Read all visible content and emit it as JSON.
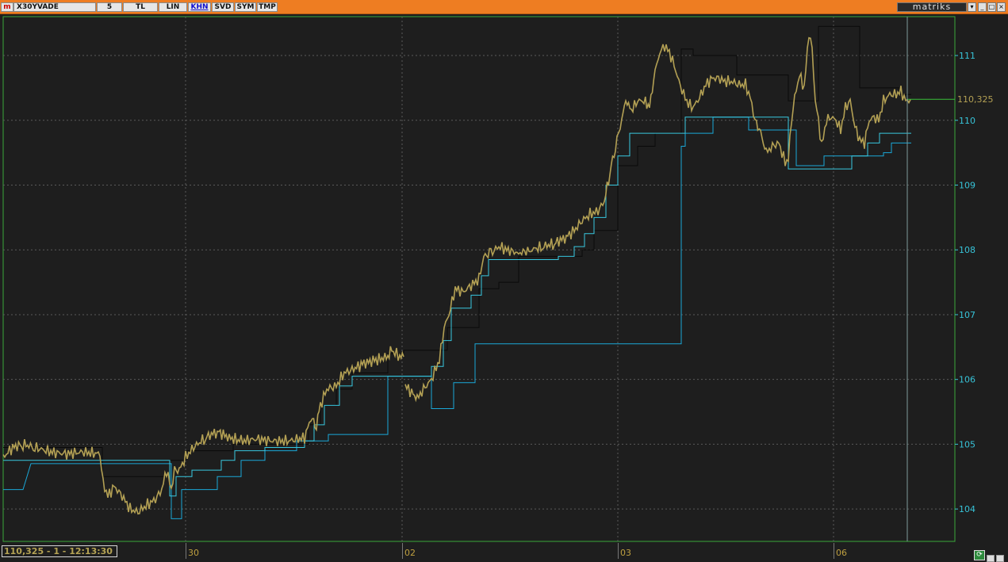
{
  "toolbar": {
    "logo": "m",
    "symbol": "X30YVADE",
    "buttons": [
      {
        "label": "5",
        "active": false
      },
      {
        "label": "TL",
        "active": false
      },
      {
        "label": "LIN",
        "active": false
      },
      {
        "label": "KHN",
        "active": true
      },
      {
        "label": "SVD",
        "active": false
      },
      {
        "label": "SYM",
        "active": false
      },
      {
        "label": "TMP",
        "active": false
      }
    ],
    "brand": "matriks",
    "window_controls": [
      "▾",
      "_",
      "□",
      "×"
    ]
  },
  "footer": {
    "readout": "110,325 - 1 - 12:13:30",
    "dates": [
      "30",
      "02",
      "03",
      "06"
    ]
  },
  "chart_data": {
    "type": "line",
    "price_label": "110,325",
    "y_ticks": [
      "104",
      "105",
      "106",
      "107",
      "108",
      "109",
      "110",
      "111"
    ],
    "ylim": [
      103.5,
      111.6
    ],
    "grid": true,
    "colors": {
      "price": "#b3a054",
      "upper_band": "#0a0a0a",
      "lower_band": "#38c8e0",
      "support": "#1aa8d8",
      "last_price_line": "#39c039",
      "axis_labels": "#37c3d8",
      "grid": "#5a5a5a"
    },
    "series": [
      {
        "key": "price",
        "values": [
          [
            0,
            104.8
          ],
          [
            12,
            104.95
          ],
          [
            25,
            105.0
          ],
          [
            40,
            104.95
          ],
          [
            60,
            104.88
          ],
          [
            80,
            104.85
          ],
          [
            100,
            104.88
          ],
          [
            122,
            104.85
          ],
          [
            126,
            104.4
          ],
          [
            132,
            104.2
          ],
          [
            140,
            104.35
          ],
          [
            150,
            104.2
          ],
          [
            160,
            104.0
          ],
          [
            170,
            103.95
          ],
          [
            180,
            104.05
          ],
          [
            192,
            104.15
          ],
          [
            200,
            104.3
          ],
          [
            206,
            104.6
          ],
          [
            212,
            104.3
          ],
          [
            216,
            104.6
          ],
          [
            222,
            104.6
          ],
          [
            230,
            104.8
          ],
          [
            240,
            104.95
          ],
          [
            255,
            105.1
          ],
          [
            270,
            105.2
          ],
          [
            285,
            105.1
          ],
          [
            300,
            105.05
          ],
          [
            320,
            105.08
          ],
          [
            340,
            105.05
          ],
          [
            360,
            105.05
          ],
          [
            380,
            105.1
          ],
          [
            388,
            105.4
          ],
          [
            395,
            105.3
          ],
          [
            400,
            105.6
          ],
          [
            408,
            105.85
          ],
          [
            420,
            105.9
          ],
          [
            430,
            106.1
          ],
          [
            440,
            106.15
          ],
          [
            455,
            106.25
          ],
          [
            470,
            106.3
          ],
          [
            485,
            106.35
          ],
          [
            490,
            106.45
          ],
          [
            500,
            106.35
          ],
          [
            505,
            106.35
          ]
        ]
      },
      {
        "key": "price2",
        "values": [
          [
            507,
            105.9
          ],
          [
            515,
            105.8
          ],
          [
            522,
            105.7
          ],
          [
            530,
            105.85
          ],
          [
            540,
            106.0
          ],
          [
            550,
            106.3
          ],
          [
            556,
            106.8
          ],
          [
            562,
            107.0
          ],
          [
            570,
            107.4
          ],
          [
            580,
            107.35
          ],
          [
            590,
            107.45
          ],
          [
            600,
            107.55
          ],
          [
            606,
            107.9
          ],
          [
            615,
            107.95
          ],
          [
            625,
            108.05
          ],
          [
            635,
            108.0
          ],
          [
            650,
            107.95
          ],
          [
            665,
            108.0
          ],
          [
            680,
            108.05
          ],
          [
            695,
            108.1
          ],
          [
            710,
            108.2
          ],
          [
            720,
            108.3
          ],
          [
            730,
            108.45
          ],
          [
            740,
            108.55
          ],
          [
            750,
            108.6
          ],
          [
            758,
            108.75
          ],
          [
            765,
            109.2
          ],
          [
            772,
            109.6
          ],
          [
            778,
            109.9
          ],
          [
            785,
            110.3
          ],
          [
            792,
            110.15
          ],
          [
            800,
            110.3
          ],
          [
            808,
            110.3
          ],
          [
            815,
            110.2
          ],
          [
            822,
            110.75
          ],
          [
            828,
            111.05
          ],
          [
            834,
            111.15
          ],
          [
            840,
            111.05
          ],
          [
            846,
            110.85
          ],
          [
            852,
            110.6
          ],
          [
            858,
            110.4
          ],
          [
            864,
            110.25
          ],
          [
            870,
            110.2
          ],
          [
            878,
            110.35
          ],
          [
            886,
            110.55
          ],
          [
            894,
            110.65
          ],
          [
            902,
            110.65
          ],
          [
            910,
            110.6
          ],
          [
            918,
            110.6
          ],
          [
            928,
            110.55
          ],
          [
            936,
            110.55
          ],
          [
            942,
            110.35
          ],
          [
            948,
            110.0
          ],
          [
            955,
            109.8
          ],
          [
            962,
            109.5
          ],
          [
            970,
            109.6
          ],
          [
            978,
            109.65
          ],
          [
            986,
            109.35
          ],
          [
            990,
            109.4
          ],
          [
            994,
            110.0
          ],
          [
            998,
            110.35
          ],
          [
            1004,
            110.7
          ],
          [
            1010,
            110.5
          ],
          [
            1016,
            111.35
          ],
          [
            1020,
            111.1
          ],
          [
            1024,
            110.3
          ],
          [
            1028,
            110.0
          ],
          [
            1032,
            109.6
          ],
          [
            1038,
            110.0
          ],
          [
            1044,
            110.05
          ],
          [
            1050,
            110.0
          ],
          [
            1056,
            109.85
          ],
          [
            1062,
            110.2
          ],
          [
            1068,
            110.3
          ],
          [
            1074,
            109.9
          ],
          [
            1080,
            109.7
          ],
          [
            1086,
            109.65
          ],
          [
            1092,
            110.0
          ],
          [
            1098,
            110.05
          ],
          [
            1104,
            110.0
          ],
          [
            1110,
            110.3
          ],
          [
            1118,
            110.4
          ],
          [
            1126,
            110.4
          ],
          [
            1132,
            110.45
          ],
          [
            1138,
            110.3
          ],
          [
            1144,
            110.32
          ]
        ]
      },
      {
        "key": "upper_band",
        "values": [
          [
            0,
            104.95
          ],
          [
            125,
            104.95
          ],
          [
            125,
            104.5
          ],
          [
            210,
            104.5
          ],
          [
            210,
            104.75
          ],
          [
            230,
            104.75
          ],
          [
            230,
            104.9
          ],
          [
            290,
            104.9
          ],
          [
            290,
            105.0
          ],
          [
            385,
            105.0
          ],
          [
            385,
            105.3
          ],
          [
            400,
            105.3
          ],
          [
            400,
            105.6
          ],
          [
            420,
            105.6
          ],
          [
            420,
            105.85
          ],
          [
            440,
            105.85
          ],
          [
            440,
            106.1
          ],
          [
            485,
            106.1
          ],
          [
            485,
            106.4
          ],
          [
            505,
            106.4
          ],
          [
            505,
            106.45
          ],
          [
            560,
            106.45
          ],
          [
            560,
            106.8
          ],
          [
            600,
            106.8
          ],
          [
            600,
            107.4
          ],
          [
            625,
            107.4
          ],
          [
            625,
            107.5
          ],
          [
            650,
            107.5
          ],
          [
            650,
            107.9
          ],
          [
            730,
            107.9
          ],
          [
            730,
            108.0
          ],
          [
            745,
            108.0
          ],
          [
            745,
            108.3
          ],
          [
            775,
            108.3
          ],
          [
            775,
            109.3
          ],
          [
            800,
            109.3
          ],
          [
            800,
            109.6
          ],
          [
            822,
            109.6
          ],
          [
            822,
            109.8
          ],
          [
            855,
            109.8
          ],
          [
            855,
            111.1
          ],
          [
            870,
            111.1
          ],
          [
            870,
            111.0
          ],
          [
            925,
            111.0
          ],
          [
            925,
            110.7
          ],
          [
            990,
            110.7
          ],
          [
            990,
            110.3
          ],
          [
            1028,
            110.3
          ],
          [
            1028,
            111.45
          ],
          [
            1080,
            111.45
          ],
          [
            1080,
            110.5
          ],
          [
            1130,
            110.5
          ],
          [
            1130,
            110.4
          ],
          [
            1145,
            110.4
          ]
        ]
      },
      {
        "key": "lower_band",
        "values": [
          [
            0,
            104.75
          ],
          [
            210,
            104.75
          ],
          [
            210,
            104.2
          ],
          [
            218,
            104.2
          ],
          [
            218,
            104.5
          ],
          [
            238,
            104.5
          ],
          [
            238,
            104.6
          ],
          [
            275,
            104.6
          ],
          [
            275,
            104.75
          ],
          [
            292,
            104.75
          ],
          [
            292,
            104.9
          ],
          [
            330,
            104.9
          ],
          [
            330,
            104.95
          ],
          [
            380,
            104.95
          ],
          [
            380,
            105.05
          ],
          [
            392,
            105.05
          ],
          [
            392,
            105.3
          ],
          [
            405,
            105.3
          ],
          [
            405,
            105.6
          ],
          [
            424,
            105.6
          ],
          [
            424,
            105.9
          ],
          [
            440,
            105.9
          ],
          [
            440,
            106.05
          ],
          [
            485,
            106.05
          ],
          [
            485,
            106.05
          ],
          [
            540,
            106.05
          ],
          [
            540,
            106.2
          ],
          [
            555,
            106.2
          ],
          [
            555,
            106.6
          ],
          [
            565,
            106.6
          ],
          [
            565,
            107.1
          ],
          [
            590,
            107.1
          ],
          [
            590,
            107.3
          ],
          [
            603,
            107.3
          ],
          [
            603,
            107.6
          ],
          [
            612,
            107.6
          ],
          [
            612,
            107.85
          ],
          [
            700,
            107.85
          ],
          [
            700,
            107.9
          ],
          [
            720,
            107.9
          ],
          [
            720,
            108.05
          ],
          [
            733,
            108.05
          ],
          [
            733,
            108.25
          ],
          [
            745,
            108.25
          ],
          [
            745,
            108.5
          ],
          [
            760,
            108.5
          ],
          [
            760,
            109.0
          ],
          [
            775,
            109.0
          ],
          [
            775,
            109.45
          ],
          [
            790,
            109.45
          ],
          [
            790,
            109.8
          ],
          [
            860,
            109.8
          ],
          [
            860,
            110.05
          ],
          [
            990,
            110.05
          ],
          [
            990,
            109.25
          ],
          [
            1070,
            109.25
          ],
          [
            1070,
            109.45
          ],
          [
            1090,
            109.45
          ],
          [
            1090,
            109.65
          ],
          [
            1105,
            109.65
          ],
          [
            1105,
            109.8
          ],
          [
            1145,
            109.8
          ]
        ]
      },
      {
        "key": "support",
        "values": [
          [
            0,
            104.3
          ],
          [
            25,
            104.3
          ],
          [
            35,
            104.7
          ],
          [
            125,
            104.7
          ],
          [
            125,
            104.7
          ],
          [
            212,
            104.7
          ],
          [
            212,
            103.85
          ],
          [
            225,
            103.85
          ],
          [
            225,
            104.3
          ],
          [
            270,
            104.3
          ],
          [
            270,
            104.5
          ],
          [
            300,
            104.5
          ],
          [
            300,
            104.75
          ],
          [
            330,
            104.75
          ],
          [
            330,
            104.9
          ],
          [
            370,
            104.9
          ],
          [
            370,
            105.05
          ],
          [
            410,
            105.05
          ],
          [
            410,
            105.15
          ],
          [
            485,
            105.15
          ],
          [
            485,
            106.05
          ],
          [
            540,
            106.05
          ],
          [
            540,
            105.55
          ],
          [
            568,
            105.55
          ],
          [
            568,
            105.95
          ],
          [
            595,
            105.95
          ],
          [
            595,
            106.55
          ],
          [
            855,
            106.55
          ],
          [
            855,
            109.6
          ],
          [
            860,
            109.6
          ],
          [
            860,
            109.8
          ],
          [
            895,
            109.8
          ],
          [
            895,
            110.05
          ],
          [
            940,
            110.05
          ],
          [
            940,
            109.85
          ],
          [
            1000,
            109.85
          ],
          [
            1000,
            109.3
          ],
          [
            1035,
            109.3
          ],
          [
            1035,
            109.45
          ],
          [
            1070,
            109.45
          ],
          [
            1070,
            109.45
          ],
          [
            1110,
            109.45
          ],
          [
            1110,
            109.5
          ],
          [
            1120,
            109.5
          ],
          [
            1120,
            109.65
          ],
          [
            1145,
            109.65
          ]
        ]
      }
    ]
  }
}
